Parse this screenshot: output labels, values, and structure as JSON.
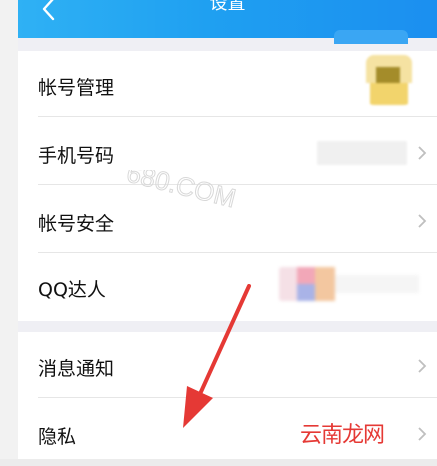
{
  "header": {
    "title": "设置",
    "back_icon": "chevron-left-icon"
  },
  "sections": [
    {
      "items": [
        {
          "label": "帐号管理",
          "right": "avatar"
        },
        {
          "label": "手机号码",
          "right": "phone"
        },
        {
          "label": "帐号安全",
          "right": "none"
        },
        {
          "label": "QQ达人",
          "right": "badges"
        }
      ]
    },
    {
      "items": [
        {
          "label": "消息通知",
          "right": "none"
        },
        {
          "label": "隐私",
          "right": "none"
        }
      ]
    }
  ],
  "watermarks": {
    "site_top": "680.COM",
    "site_bottom": "云南龙网"
  },
  "colors": {
    "header_start": "#2fb1f4",
    "header_end": "#1b8ff0",
    "arrow": "#e53935",
    "chevron": "#bfbfbf"
  }
}
